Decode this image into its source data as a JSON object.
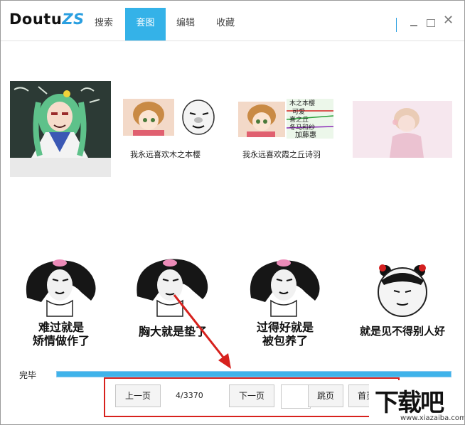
{
  "app": {
    "logo_main": "Doutu",
    "logo_suffix": "ZS"
  },
  "tabs": [
    {
      "label": "搜索"
    },
    {
      "label": "套图"
    },
    {
      "label": "编辑"
    },
    {
      "label": "收藏"
    }
  ],
  "active_tab": "套图",
  "window_controls": {
    "minimize": "minimize-icon",
    "maximize": "maximize-icon",
    "close": "close-icon"
  },
  "row1": [
    {
      "caption": ""
    },
    {
      "caption": "我永远喜欢木之本樱"
    },
    {
      "caption": "我永远喜欢霞之丘诗羽",
      "overlay_lines": [
        "木之本樱",
        "可爱",
        "喜之丘",
        "冬马和纱",
        "加藤惠"
      ]
    },
    {
      "caption": ""
    }
  ],
  "row2": [
    {
      "caption": "难过就是\n矫情做作了"
    },
    {
      "caption": "胸大就是垫了"
    },
    {
      "caption": "过得好就是\n被包养了"
    },
    {
      "caption": "就是见不得别人好"
    }
  ],
  "status": {
    "text": "完毕",
    "progress": 1.0
  },
  "pager": {
    "prev_label": "上一页",
    "page_info": "4/3370",
    "next_label": "下一页",
    "jump_value": "",
    "jump_label": "跳页",
    "first_label": "首页"
  },
  "watermark": {
    "big": "下载吧",
    "small": "www.xiazaiba.com"
  },
  "colors": {
    "accent": "#34b2e8",
    "highlight_box": "#d7211d",
    "arrow": "#d7211d"
  }
}
